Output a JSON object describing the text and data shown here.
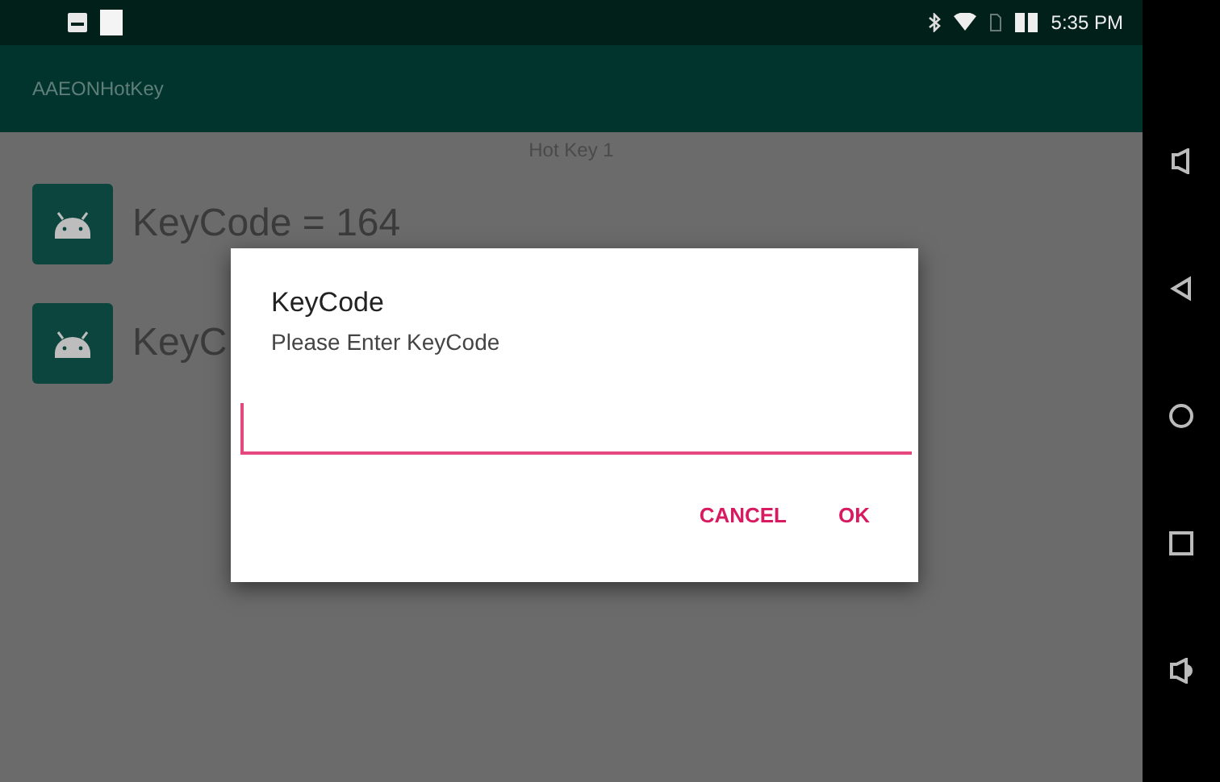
{
  "status_bar": {
    "time": "5:35 PM"
  },
  "app_bar": {
    "title": "AAEONHotKey"
  },
  "list": {
    "header": "Hot Key 1",
    "items": [
      {
        "label": "KeyCode = 164"
      },
      {
        "label": "KeyC"
      }
    ]
  },
  "dialog": {
    "title": "KeyCode",
    "message": "Please Enter KeyCode",
    "input": {
      "focused": true
    },
    "buttons": [
      "CANCEL",
      "OK"
    ]
  }
}
